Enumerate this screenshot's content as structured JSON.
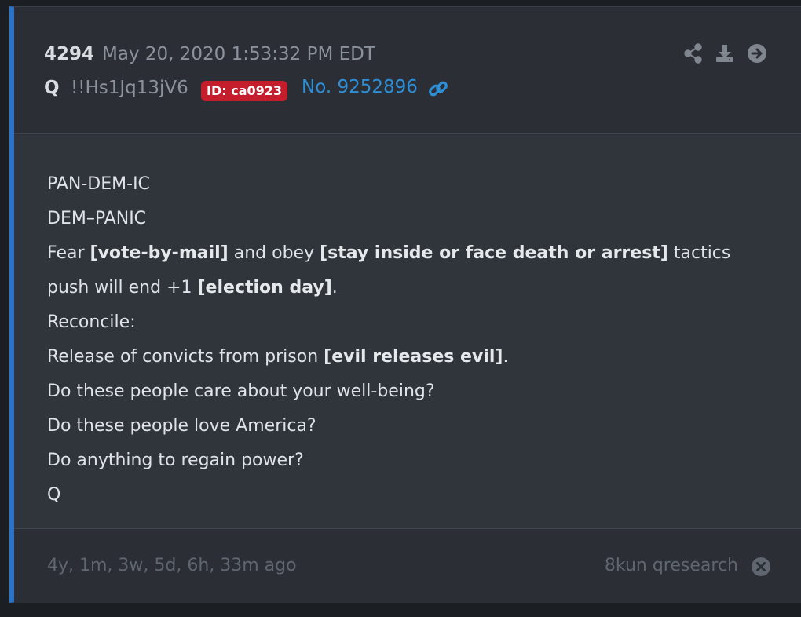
{
  "post": {
    "number": "4294",
    "date": "May 20, 2020 1:53:32 PM EDT",
    "author": "Q",
    "tripcode": "!!Hs1Jq13jV6",
    "id_badge": "ID: ca0923",
    "post_no": "No. 9252896"
  },
  "header_icons": [
    "share-icon",
    "download-icon",
    "arrow-right-circle-icon"
  ],
  "body": {
    "line1": "PAN-DEM-IC",
    "line2": "DEM–PANIC",
    "line3": {
      "a": "Fear ",
      "b": "[vote-by-mail]",
      "c": " and obey ",
      "d": "[stay inside or face death or arrest]",
      "e": " tactics"
    },
    "line4": {
      "a": "push will end +1 ",
      "b": "[election day]",
      "c": "."
    },
    "line5": "Reconcile:",
    "line6": {
      "a": "Release of convicts from prison ",
      "b": "[evil releases evil]",
      "c": "."
    },
    "line7": "Do these people care about your well-being?",
    "line8": "Do these people love America?",
    "line9": "Do anything to regain power?",
    "line10": "Q"
  },
  "footer": {
    "ago": "4y, 1m, 3w, 5d, 6h, 33m ago",
    "board": "8kun qresearch"
  },
  "colors": {
    "accent": "#2a73c9",
    "link": "#2e8fd6",
    "badge": "#c41d2c"
  }
}
